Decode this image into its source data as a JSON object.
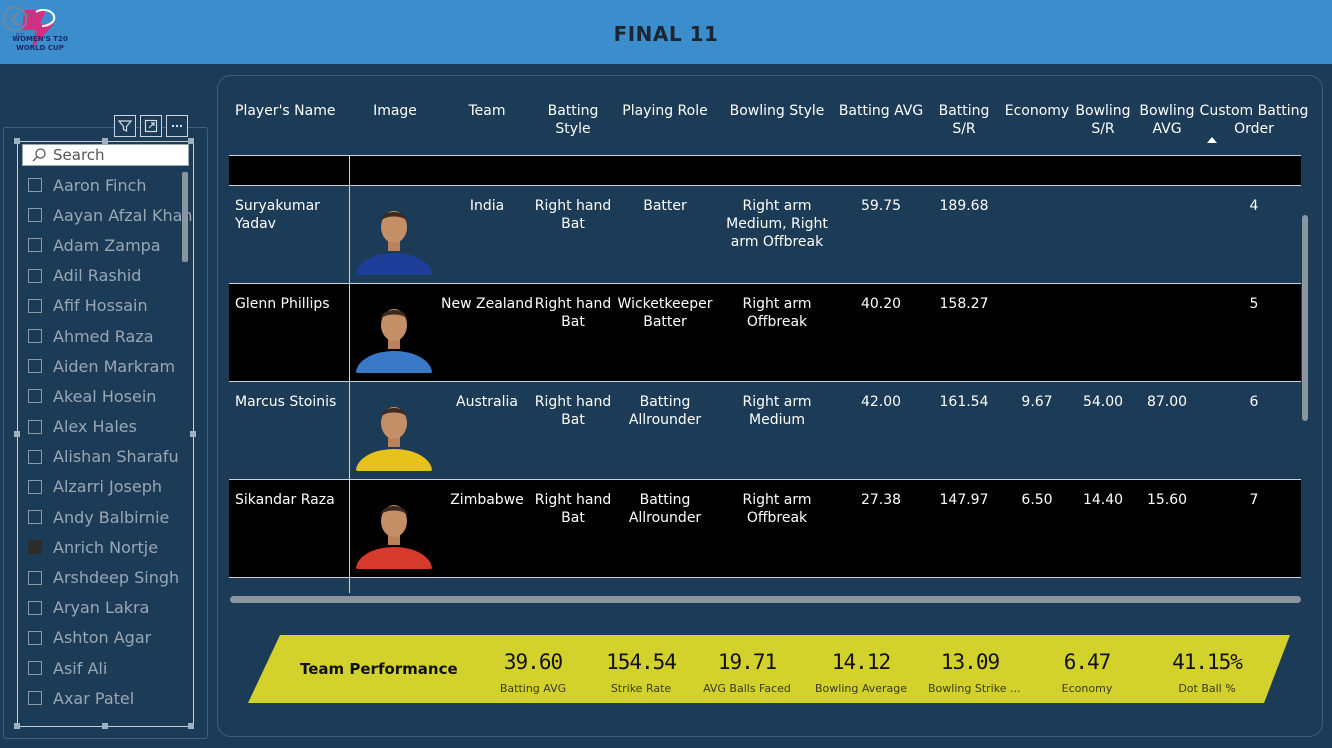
{
  "header": {
    "title": "FINAL 11",
    "logo_text": [
      "ICC",
      "WOMEN'S T20",
      "WORLD CUP"
    ]
  },
  "slicer": {
    "search_placeholder": "Search",
    "items": [
      {
        "name": "Aaron Finch",
        "checked": false
      },
      {
        "name": "Aayan Afzal Khan",
        "checked": false
      },
      {
        "name": "Adam Zampa",
        "checked": false
      },
      {
        "name": "Adil Rashid",
        "checked": false
      },
      {
        "name": "Afif Hossain",
        "checked": false
      },
      {
        "name": "Ahmed Raza",
        "checked": false
      },
      {
        "name": "Aiden Markram",
        "checked": false
      },
      {
        "name": "Akeal Hosein",
        "checked": false
      },
      {
        "name": "Alex Hales",
        "checked": false
      },
      {
        "name": "Alishan Sharafu",
        "checked": false
      },
      {
        "name": "Alzarri Joseph",
        "checked": false
      },
      {
        "name": "Andy Balbirnie",
        "checked": false
      },
      {
        "name": "Anrich Nortje",
        "checked": true
      },
      {
        "name": "Arshdeep Singh",
        "checked": false
      },
      {
        "name": "Aryan Lakra",
        "checked": false
      },
      {
        "name": "Ashton Agar",
        "checked": false
      },
      {
        "name": "Asif Ali",
        "checked": false
      },
      {
        "name": "Axar Patel",
        "checked": false
      }
    ]
  },
  "table": {
    "columns": [
      "Player's Name",
      "Image",
      "Team",
      "Batting Style",
      "Playing Role",
      "Bowling Style",
      "Batting AVG",
      "Batting S/R",
      "Economy",
      "Bowling S/R",
      "Bowling AVG",
      "Custom Batting Order"
    ],
    "rows": [
      {
        "name": "Suryakumar Yadav",
        "team": "India",
        "batting_style": "Right hand Bat",
        "role": "Batter",
        "bowling_style": "Right arm Medium, Right arm Offbreak",
        "bat_avg": "59.75",
        "bat_sr": "189.68",
        "economy": "",
        "bowl_sr": "",
        "bowl_avg": "",
        "order": "4",
        "jersey": "#1f3e9a"
      },
      {
        "name": "Glenn Phillips",
        "team": "New Zealand",
        "batting_style": "Right hand Bat",
        "role": "Wicketkeeper Batter",
        "bowling_style": "Right arm Offbreak",
        "bat_avg": "40.20",
        "bat_sr": "158.27",
        "economy": "",
        "bowl_sr": "",
        "bowl_avg": "",
        "order": "5",
        "jersey": "#3a78c8"
      },
      {
        "name": "Marcus Stoinis",
        "team": "Australia",
        "batting_style": "Right hand Bat",
        "role": "Batting Allrounder",
        "bowling_style": "Right arm Medium",
        "bat_avg": "42.00",
        "bat_sr": "161.54",
        "economy": "9.67",
        "bowl_sr": "54.00",
        "bowl_avg": "87.00",
        "order": "6",
        "jersey": "#e8c21c"
      },
      {
        "name": "Sikandar Raza",
        "team": "Zimbabwe",
        "batting_style": "Right hand Bat",
        "role": "Batting Allrounder",
        "bowling_style": "Right arm Offbreak",
        "bat_avg": "27.38",
        "bat_sr": "147.97",
        "economy": "6.50",
        "bowl_sr": "14.40",
        "bowl_avg": "15.60",
        "order": "7",
        "jersey": "#d63a2a"
      }
    ]
  },
  "performance": {
    "title": "Team Performance",
    "kpis": [
      {
        "value": "39.60",
        "label": "Batting AVG"
      },
      {
        "value": "154.54",
        "label": "Strike Rate"
      },
      {
        "value": "19.71",
        "label": "AVG Balls Faced"
      },
      {
        "value": "14.12",
        "label": "Bowling Average"
      },
      {
        "value": "13.09",
        "label": "Bowling Strike ..."
      },
      {
        "value": "6.47",
        "label": "Economy"
      },
      {
        "value": "41.15%",
        "label": "Dot Ball %"
      }
    ]
  },
  "colors": {
    "background": "#1b3b57",
    "header": "#3c8dcb",
    "performance_bar": "#d3d12b",
    "row_dark": "#000000"
  }
}
